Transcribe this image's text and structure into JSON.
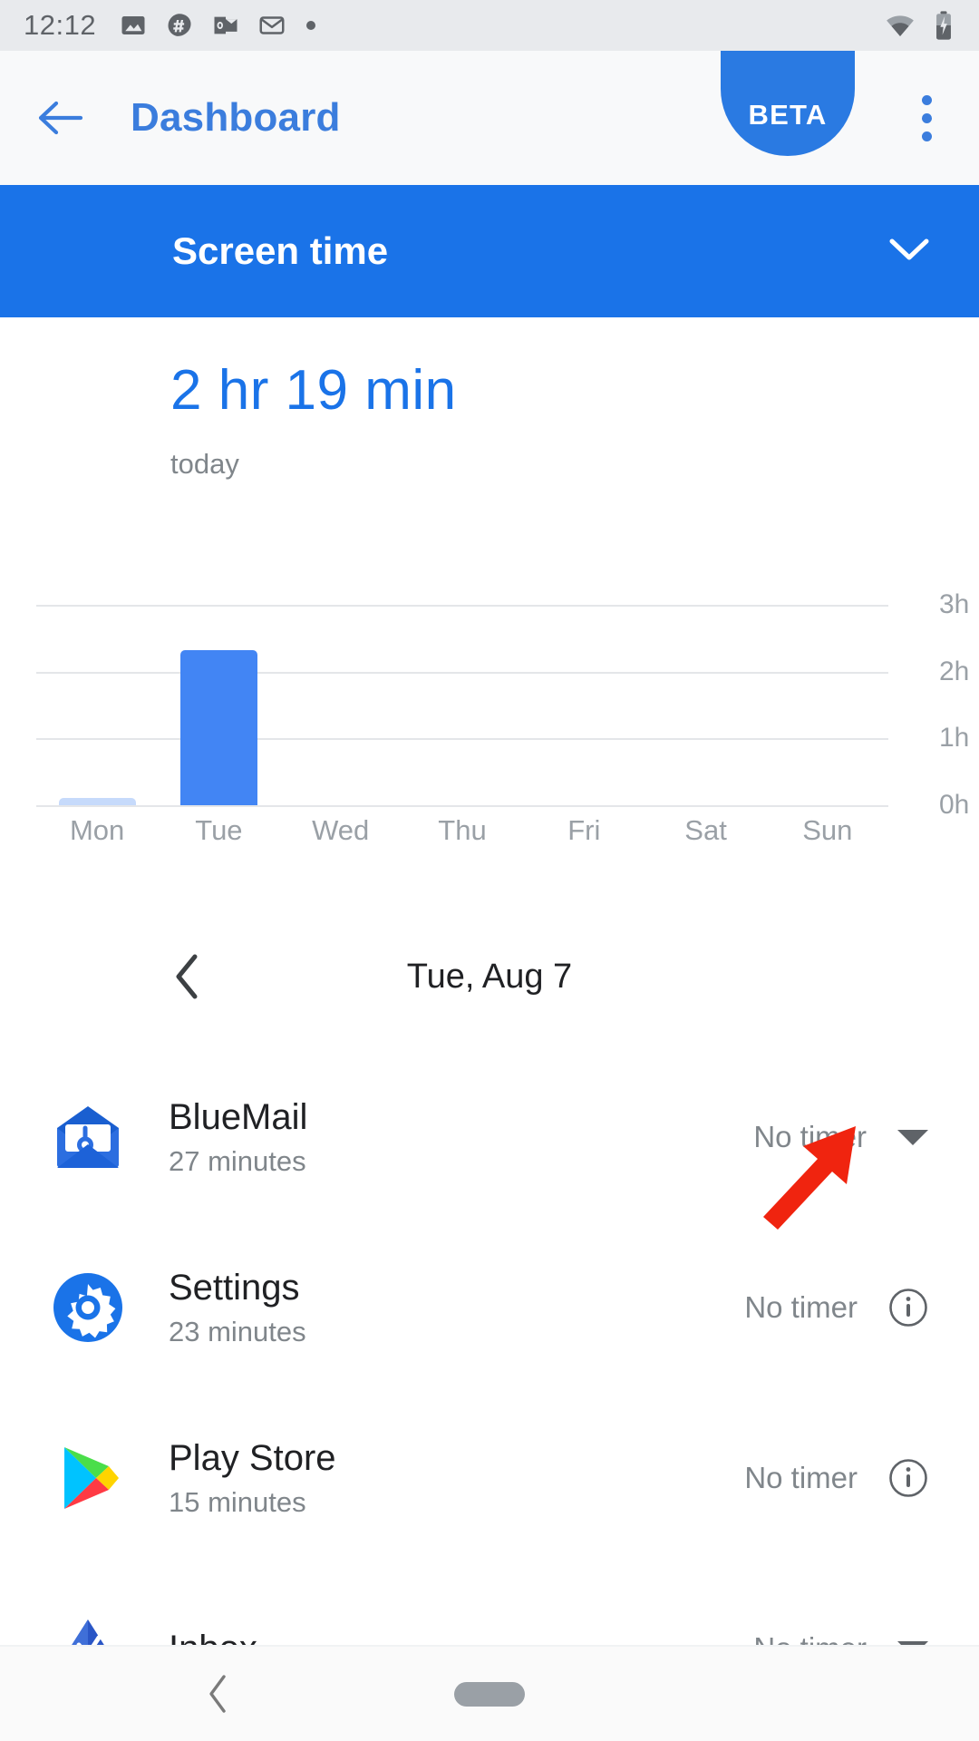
{
  "status_bar": {
    "clock": "12:12",
    "left_icons": [
      "photos-icon",
      "slack-icon",
      "outlook-icon",
      "mail-icon",
      "dot-icon"
    ],
    "right_icons": [
      "wifi-icon",
      "battery-charging-icon"
    ]
  },
  "app_bar": {
    "back_icon": "back-arrow-icon",
    "title": "Dashboard",
    "beta_label": "BETA",
    "overflow_icon": "overflow-menu-icon"
  },
  "section": {
    "title": "Screen time",
    "chevron_icon": "chevron-down-icon",
    "accent_color": "#1a73e8"
  },
  "summary": {
    "total": "2 hr 19 min",
    "period": "today"
  },
  "chart_data": {
    "type": "bar",
    "title": "",
    "xlabel": "",
    "ylabel": "",
    "categories": [
      "Mon",
      "Tue",
      "Wed",
      "Thu",
      "Fri",
      "Sat",
      "Sun"
    ],
    "values": [
      0.05,
      2.32,
      0,
      0,
      0,
      0,
      0
    ],
    "value_labels": [
      "",
      "2 hr 19 min",
      "",
      "",
      "",
      "",
      ""
    ],
    "ytick_labels": [
      "0h",
      "1h",
      "2h",
      "3h"
    ],
    "yticks": [
      0,
      1,
      2,
      3
    ],
    "ylim": [
      0,
      3.15
    ],
    "grid": true,
    "legend": "none",
    "bar_colors": [
      "#c6dafb",
      "#4285f4",
      "#4285f4",
      "#4285f4",
      "#4285f4",
      "#4285f4",
      "#4285f4"
    ],
    "highlight_index": 1
  },
  "date_nav": {
    "prev_icon": "chevron-left-icon",
    "label": "Tue, Aug 7"
  },
  "apps": [
    {
      "icon": "bluemail-icon",
      "name": "BlueMail",
      "usage": "27 minutes",
      "timer": "No timer",
      "control": "dropdown"
    },
    {
      "icon": "settings-icon",
      "name": "Settings",
      "usage": "23 minutes",
      "timer": "No timer",
      "control": "info"
    },
    {
      "icon": "playstore-icon",
      "name": "Play Store",
      "usage": "15 minutes",
      "timer": "No timer",
      "control": "info"
    },
    {
      "icon": "inbox-icon",
      "name": "Inbox",
      "usage": "",
      "timer": "No timer",
      "control": "dropdown"
    }
  ],
  "annotation": {
    "arrow_color": "#f0240f",
    "points_to": "bluemail-timer-dropdown"
  },
  "nav_bar": {
    "back_icon": "nav-back-icon",
    "home_icon": "nav-home-pill"
  }
}
